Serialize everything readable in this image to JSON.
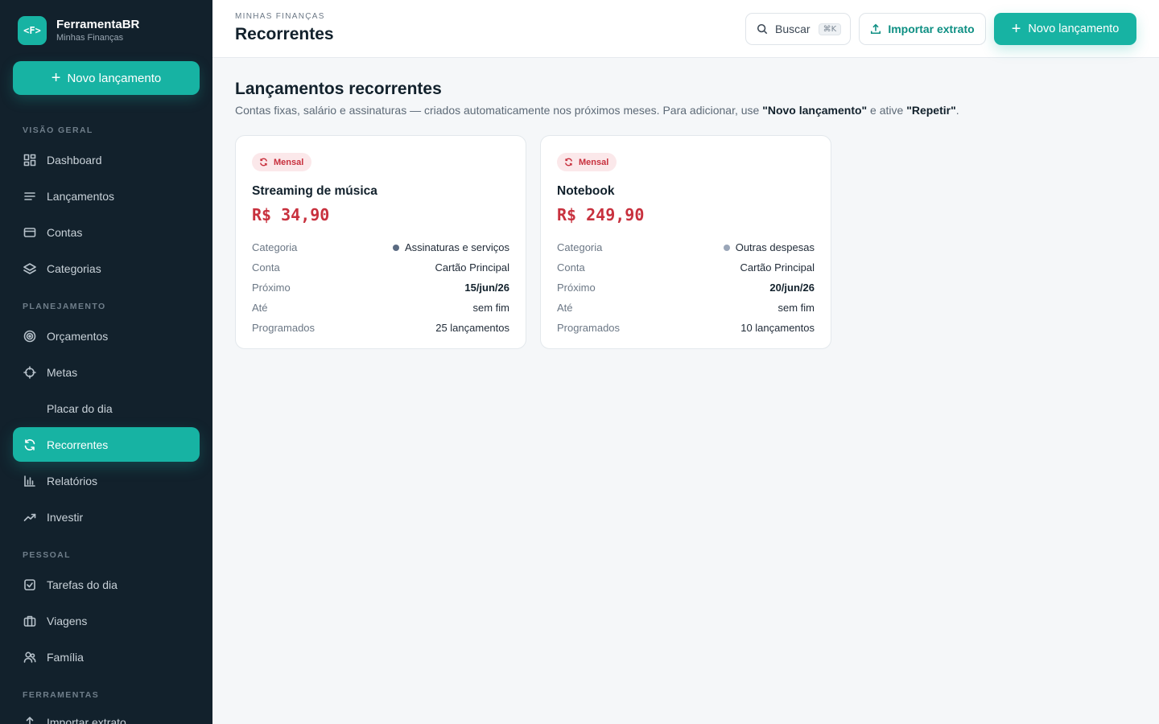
{
  "app": {
    "logo_text": "<F>",
    "name": "FerramentaBR",
    "subtitle": "Minhas Finanças",
    "accent_color": "#17b3a3"
  },
  "sidebar": {
    "new_button_label": "Novo lançamento",
    "sections": {
      "visao_geral": "VISÃO GERAL",
      "planejamento": "PLANEJAMENTO",
      "pessoal": "PESSOAL",
      "ferramentas": "FERRAMENTAS"
    },
    "items": [
      {
        "label": "Dashboard",
        "icon": "grid-icon"
      },
      {
        "label": "Lançamentos",
        "icon": "list-icon"
      },
      {
        "label": "Contas",
        "icon": "card-icon"
      },
      {
        "label": "Categorias",
        "icon": "layers-icon"
      },
      {
        "label": "Orçamentos",
        "icon": "target-icon"
      },
      {
        "label": "Metas",
        "icon": "crosshair-icon"
      },
      {
        "label": "Placar do dia",
        "icon": ""
      },
      {
        "label": "Recorrentes",
        "icon": "refresh-icon",
        "active": true
      },
      {
        "label": "Relatórios",
        "icon": "bar-chart-icon"
      },
      {
        "label": "Investir",
        "icon": "trending-up-icon"
      },
      {
        "label": "Tarefas do dia",
        "icon": "check-square-icon"
      },
      {
        "label": "Viagens",
        "icon": "suitcase-icon"
      },
      {
        "label": "Família",
        "icon": "users-icon"
      },
      {
        "label": "Importar extrato",
        "icon": "upload-icon"
      }
    ]
  },
  "header": {
    "breadcrumb": "MINHAS FINANÇAS",
    "title": "Recorrentes",
    "search_label": "Buscar",
    "search_shortcut": "⌘K",
    "import_label": "Importar extrato",
    "new_label": "Novo lançamento"
  },
  "main": {
    "title": "Lançamentos recorrentes",
    "subtitle_pre": "Contas fixas, salário e assinaturas — criados automaticamente nos próximos meses. Para adicionar, use ",
    "subtitle_b1": "\"Novo lançamento\"",
    "subtitle_mid": " e ative ",
    "subtitle_b2": "\"Repetir\"",
    "subtitle_end": "."
  },
  "labels": {
    "categoria": "Categoria",
    "conta": "Conta",
    "proximo": "Próximo",
    "ate": "Até",
    "programados": "Programados"
  },
  "cards": [
    {
      "badge": "Mensal",
      "name": "Streaming de música",
      "amount": "R$ 34,90",
      "categoria": "Assinaturas e serviços",
      "categoria_color": "#5b6b82",
      "conta": "Cartão Principal",
      "proximo": "15/jun/26",
      "ate": "sem fim",
      "programados": "25 lançamentos"
    },
    {
      "badge": "Mensal",
      "name": "Notebook",
      "amount": "R$ 249,90",
      "categoria": "Outras despesas",
      "categoria_color": "#9aa6b8",
      "conta": "Cartão Principal",
      "proximo": "20/jun/26",
      "ate": "sem fim",
      "programados": "10 lançamentos"
    }
  ]
}
